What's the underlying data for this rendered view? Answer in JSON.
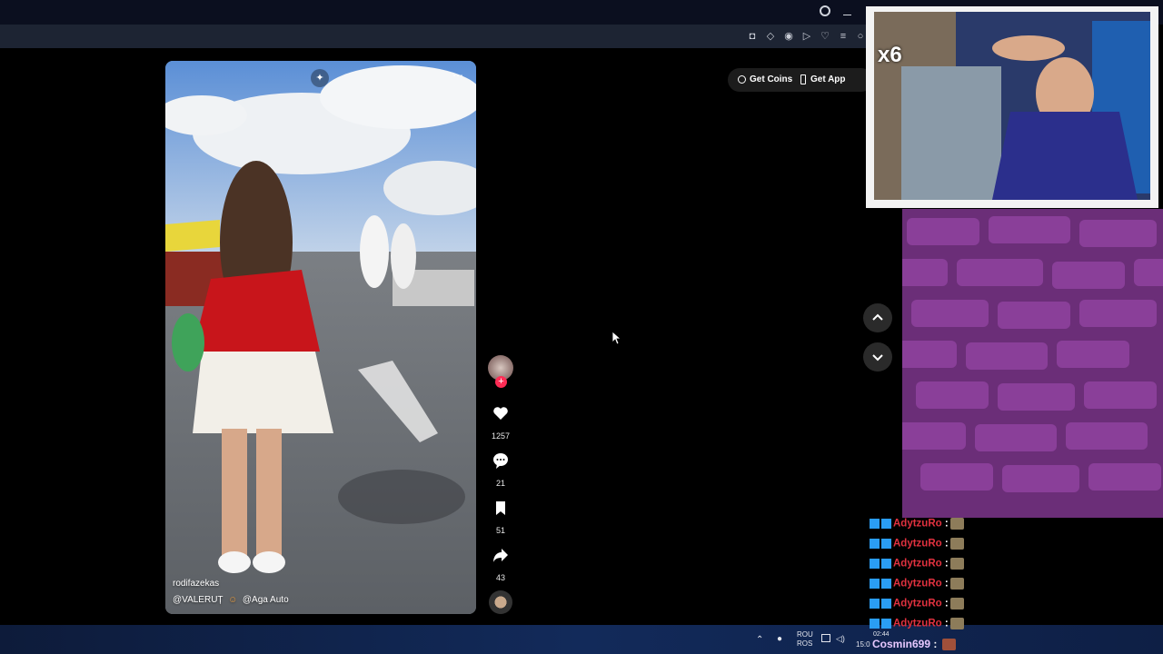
{
  "header": {
    "get_coins": "Get Coins",
    "get_app": "Get App"
  },
  "video": {
    "username": "rodifazekas",
    "mentions": [
      "@VALERUȚ",
      "@Aga Auto"
    ]
  },
  "actions": {
    "likes": "1257",
    "comments": "21",
    "saves": "51",
    "shares": "43"
  },
  "webcam": {
    "multiplier": "x6"
  },
  "chat": {
    "messages": [
      {
        "user": "AdytzuRo",
        "sep": ":"
      },
      {
        "user": "AdytzuRo",
        "sep": ":"
      },
      {
        "user": "AdytzuRo",
        "sep": ":"
      },
      {
        "user": "AdytzuRo",
        "sep": ":"
      },
      {
        "user": "AdytzuRo",
        "sep": ":"
      },
      {
        "user": "AdytzuRo",
        "sep": ":"
      }
    ],
    "last_user": "Cosmin699",
    "last_sep": ":"
  },
  "taskbar": {
    "lang_top": "ROU",
    "lang_bottom": "ROS",
    "time_fragment": "15:0",
    "clock": "02:44"
  },
  "colors": {
    "chat_name": "#e0313f",
    "chat_last_name": "#e6c8ff",
    "like_accent": "#fe2c55"
  }
}
